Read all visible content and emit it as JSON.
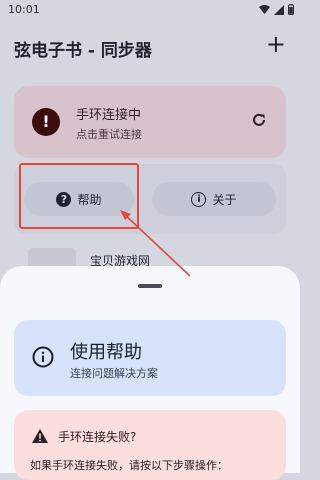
{
  "status_bar": {
    "time": "10:01"
  },
  "app_bar": {
    "title": "弦电子书 - 同步器",
    "add_label": "+"
  },
  "status_card": {
    "title": "手环连接中",
    "subtitle": "点击重试连接",
    "icon": "error-icon"
  },
  "actions": {
    "help_label": "帮助",
    "about_label": "关于"
  },
  "list": {
    "item_title": "宝贝游戏网"
  },
  "sheet": {
    "help_title": "使用帮助",
    "help_subtitle": "连接问题解决方案",
    "fail_title": "手环连接失败?",
    "fail_text": "如果手环连接失败，请按以下步骤操作："
  },
  "colors": {
    "annotation": "#e5473a",
    "error_bg": "#d8c3cd",
    "help_bg": "#d6e3fb",
    "fail_bg": "#fbdedd"
  }
}
